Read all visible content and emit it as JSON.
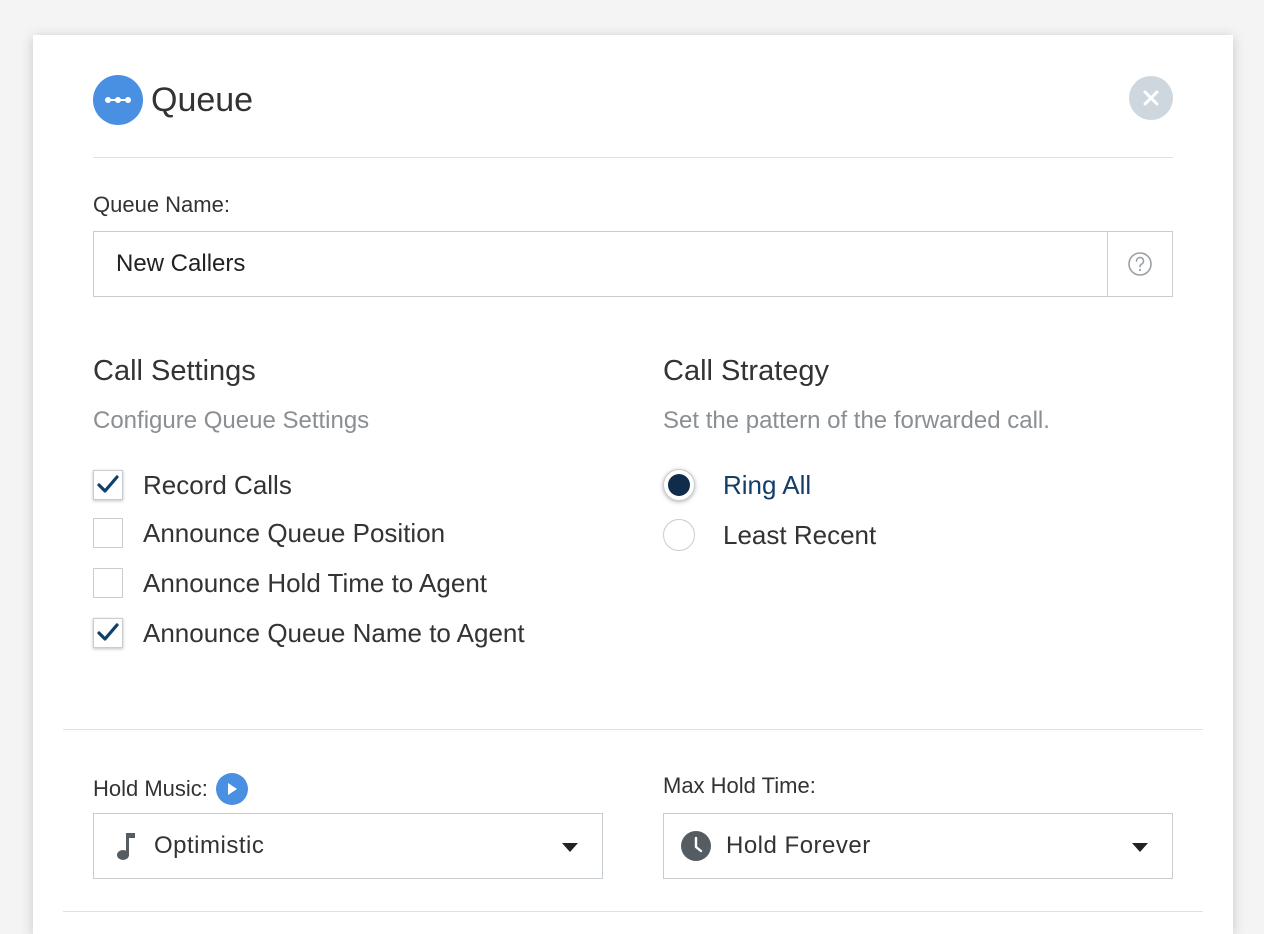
{
  "header": {
    "title": "Queue"
  },
  "queue_name": {
    "label": "Queue Name:",
    "value": "New Callers"
  },
  "call_settings": {
    "title": "Call Settings",
    "subtitle": "Configure Queue Settings",
    "options": [
      {
        "label": "Record Calls",
        "checked": true
      },
      {
        "label": "Announce Queue Position",
        "checked": false
      },
      {
        "label": "Announce Hold Time to Agent",
        "checked": false
      },
      {
        "label": "Announce Queue Name to Agent",
        "checked": true
      }
    ]
  },
  "call_strategy": {
    "title": "Call Strategy",
    "subtitle": "Set the pattern of the forwarded call.",
    "options": [
      {
        "label": "Ring All",
        "selected": true
      },
      {
        "label": "Least Recent",
        "selected": false
      }
    ]
  },
  "hold_music": {
    "label": "Hold Music:",
    "value": "Optimistic"
  },
  "max_hold_time": {
    "label": "Max Hold Time:",
    "value": "Hold Forever"
  },
  "colors": {
    "accent": "#4a90e2",
    "radio_selected": "#0f2d4b",
    "close_bg": "#cfd7de"
  },
  "icons": [
    "queue-icon",
    "close-icon",
    "help-icon",
    "checkmark-icon",
    "play-icon",
    "music-note-icon",
    "clock-icon",
    "chevron-down-icon"
  ]
}
